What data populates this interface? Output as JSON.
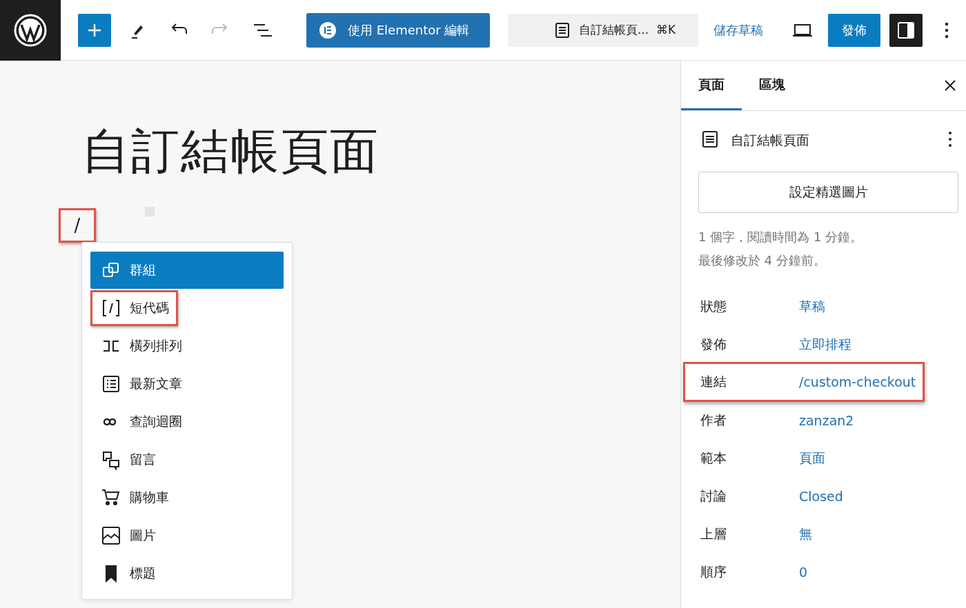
{
  "toolbar": {
    "editor_button": "使用 Elementor 編輯",
    "document_title": "自訂結帳頁...",
    "shortcut": "⌘K",
    "save_draft": "儲存草稿",
    "publish": "發佈",
    "settings_open": true
  },
  "editor": {
    "title": "自訂結帳頁面",
    "block_text": "/",
    "block_highlighted": true
  },
  "inserter": {
    "items": [
      {
        "label": "群組",
        "kind": "group",
        "selected": true,
        "highlighted": false
      },
      {
        "label": "短代碼",
        "kind": "shortcode",
        "selected": false,
        "highlighted": true
      },
      {
        "label": "橫列排列",
        "kind": "row",
        "selected": false,
        "highlighted": false
      },
      {
        "label": "最新文章",
        "kind": "list",
        "selected": false,
        "highlighted": false
      },
      {
        "label": "查詢迴圈",
        "kind": "loop",
        "selected": false,
        "highlighted": false
      },
      {
        "label": "留言",
        "kind": "comments",
        "selected": false,
        "highlighted": false
      },
      {
        "label": "購物車",
        "kind": "cart",
        "selected": false,
        "highlighted": false
      },
      {
        "label": "圖片",
        "kind": "image",
        "selected": false,
        "highlighted": false
      },
      {
        "label": "標題",
        "kind": "bookmark",
        "selected": false,
        "highlighted": false
      }
    ]
  },
  "sidebar": {
    "tabs": [
      {
        "label": "頁面",
        "selected": true
      },
      {
        "label": "區塊",
        "selected": false
      }
    ],
    "document": "自訂結帳頁面",
    "featured_image_button": "設定精選圖片",
    "stats": [
      "1 個字，閱讀時間為 1 分鐘。",
      "最後修改於 4 分鐘前。"
    ],
    "fields": [
      {
        "label": "狀態",
        "value": "草稿",
        "highlighted": false
      },
      {
        "label": "發佈",
        "value": "立即排程",
        "highlighted": false
      },
      {
        "label": "連結",
        "value": "/custom-checkout",
        "highlighted": true
      },
      {
        "label": "作者",
        "value": "zanzan2",
        "highlighted": false
      },
      {
        "label": "範本",
        "value": "頁面",
        "highlighted": false
      },
      {
        "label": "討論",
        "value": "Closed",
        "highlighted": false
      },
      {
        "label": "上層",
        "value": "無",
        "highlighted": false
      },
      {
        "label": "順序",
        "value": "0",
        "highlighted": false
      }
    ]
  }
}
